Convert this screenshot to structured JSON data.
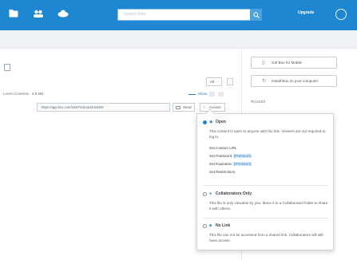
{
  "topbar": {
    "icons": [
      "files-icon",
      "people-icon",
      "cloud-icon"
    ],
    "search_placeholder": "Search Files",
    "upgrade_label": "Upgrade"
  },
  "main": {
    "sort_value": "All",
    "contents_label": "Lorem Contents · 6.8 MB",
    "show_label": "Show",
    "link_url": "https://app.box.com/s/e87ed1cad4cdd405",
    "send_label": "Send",
    "access_label": "Access"
  },
  "sidebar": {
    "mobile_button": "Get Box for Mobile",
    "install_button": "Install Box on your computer",
    "account_label": "Account"
  },
  "popup": {
    "options": [
      {
        "title": "Open",
        "selected": true,
        "description": "This content is open to anyone with the link. Viewers are not required to log in.",
        "sub_links": [
          "Set Custom URL",
          "Set Password",
          "Set Expiration",
          "Set Restrictions"
        ],
        "premium_badge": "(Premium)"
      },
      {
        "title": "Collaborators Only",
        "selected": false,
        "description": "This file is only viewable by you. Move it to a Collaborated folder to share it with others."
      },
      {
        "title": "No Link",
        "selected": false,
        "description": "This file can not be accessed from a shared link. Collaborators will still have access."
      }
    ]
  },
  "colors": {
    "brand_blue": "#1f86d1",
    "link_blue": "#2a7bc4",
    "highlight": "#d9ebf8"
  }
}
